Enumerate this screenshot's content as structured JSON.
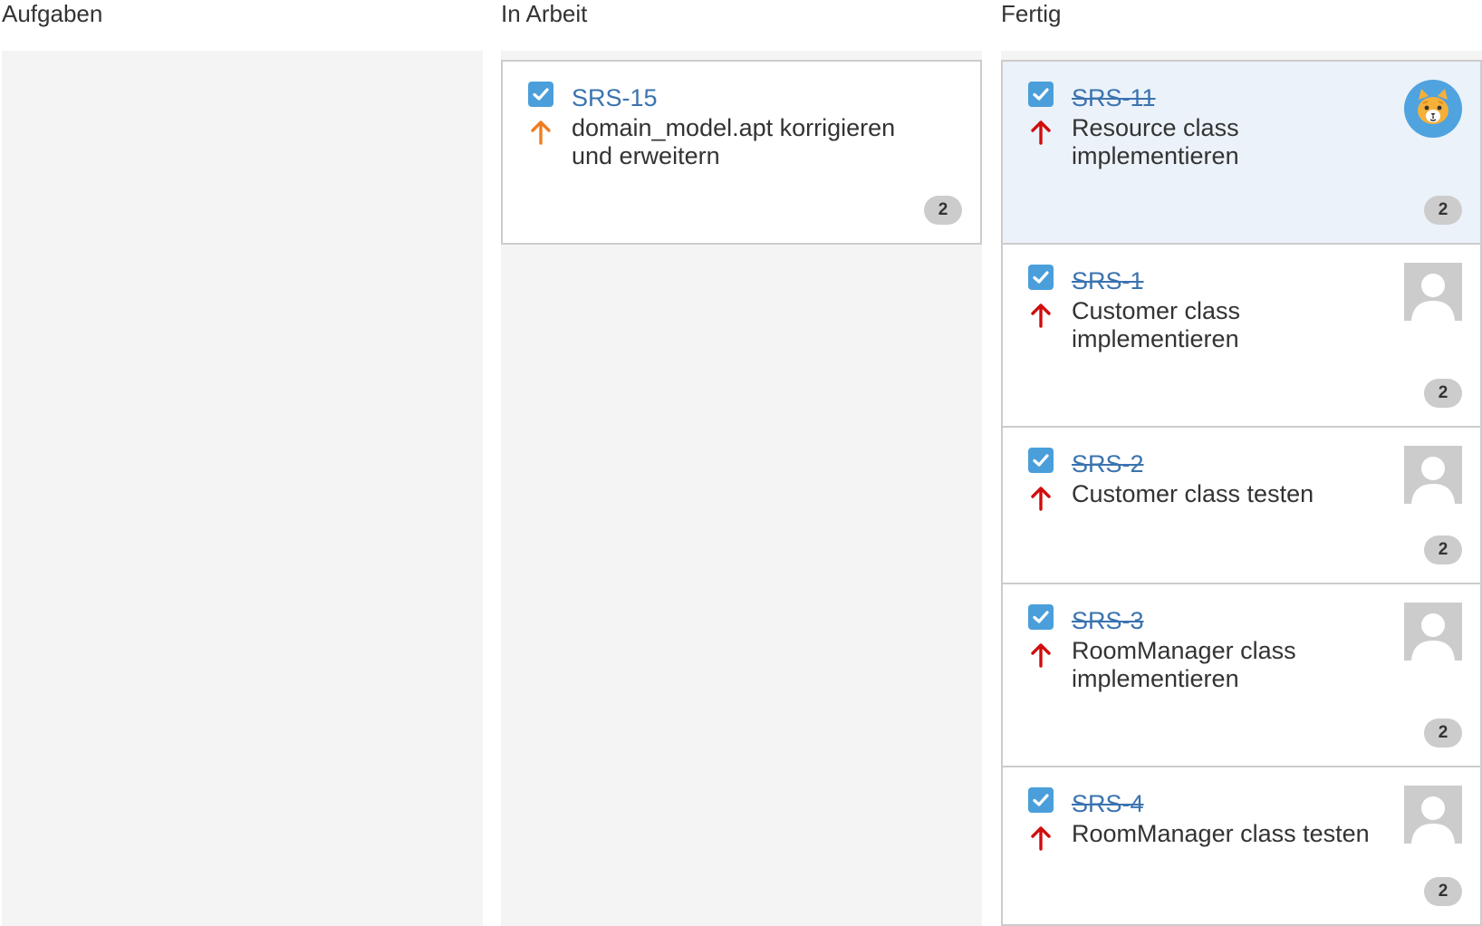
{
  "columns": [
    {
      "title": "Aufgaben",
      "issues": []
    },
    {
      "title": "In Arbeit",
      "issues": [
        {
          "key": "SRS-15",
          "summary": "domain_model.apt korrigieren und erweitern",
          "priority": "major",
          "priority_color": "#f07d20",
          "estimate": "2",
          "done": false,
          "avatar": "none"
        }
      ]
    },
    {
      "title": "Fertig",
      "issues": [
        {
          "key": "SRS-11",
          "summary": "Resource class implementieren",
          "priority": "critical",
          "priority_color": "#d00d0d",
          "estimate": "2",
          "done": true,
          "avatar": "cat-avatar-icon",
          "selected": true
        },
        {
          "key": "SRS-1",
          "summary": "Customer class implementieren",
          "priority": "critical",
          "priority_color": "#d00d0d",
          "estimate": "2",
          "done": true,
          "avatar": "default-user-avatar-icon"
        },
        {
          "key": "SRS-2",
          "summary": "Customer class testen",
          "priority": "critical",
          "priority_color": "#d00d0d",
          "estimate": "2",
          "done": true,
          "avatar": "default-user-avatar-icon"
        },
        {
          "key": "SRS-3",
          "summary": "RoomManager class implementieren",
          "priority": "critical",
          "priority_color": "#d00d0d",
          "estimate": "2",
          "done": true,
          "avatar": "default-user-avatar-icon"
        },
        {
          "key": "SRS-4",
          "summary": "RoomManager class testen",
          "priority": "critical",
          "priority_color": "#d00d0d",
          "estimate": "2",
          "done": true,
          "avatar": "default-user-avatar-icon"
        }
      ]
    }
  ],
  "colors": {
    "link": "#3b73af",
    "checkbox": "#4a9fdb",
    "column_background": "#f4f4f4",
    "selected_card": "#ebf2f9"
  }
}
